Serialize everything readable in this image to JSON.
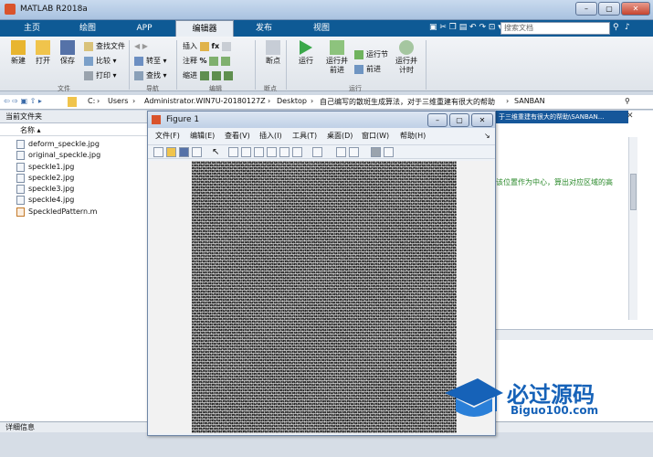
{
  "app": {
    "title": "MATLAB R2018a"
  },
  "tabs": [
    "主页",
    "绘图",
    "APP",
    "编辑器",
    "发布",
    "视图"
  ],
  "search": {
    "placeholder": "搜索文档"
  },
  "ribbon": {
    "file": {
      "new": "新建",
      "open": "打开",
      "save": "保存",
      "find_files": "查找文件",
      "compare": "比较",
      "print": "打印",
      "group": "文件"
    },
    "nav": {
      "goto": "转至",
      "find": "查找",
      "group": "导航"
    },
    "edit": {
      "insert": "插入",
      "comment": "注释",
      "indent": "缩进",
      "group": "编辑"
    },
    "breakpoints": {
      "label": "断点",
      "group": "断点"
    },
    "run": {
      "run": "运行",
      "run_advance": "运行并\n前进",
      "run_section": "运行节",
      "advance": "前进",
      "run_time": "运行并\n计时",
      "group": "运行"
    }
  },
  "address": {
    "path": [
      "C:",
      "Users",
      "Administrator.WIN7U-20180127Z",
      "Desktop",
      "自己编写的散斑生成算法，对于三维重建有很大的帮助",
      "SANBAN"
    ]
  },
  "current_folder": {
    "title": "当前文件夹",
    "column": "名称",
    "files": [
      "deform_speckle.jpg",
      "original_speckle.jpg",
      "speckle1.jpg",
      "speckle2.jpg",
      "speckle3.jpg",
      "speckle4.jpg",
      "SpeckledPattern.m"
    ]
  },
  "detail": {
    "label": "详细信息"
  },
  "editor": {
    "tab_title": "于三维重建有很大的帮助\\SANBAN...",
    "comment": "该位置作为中心，算出对应区域的高"
  },
  "figure": {
    "title": "Figure 1",
    "menu": [
      "文件(F)",
      "编辑(E)",
      "查看(V)",
      "插入(I)",
      "工具(T)",
      "桌面(D)",
      "窗口(W)",
      "帮助(H)"
    ]
  },
  "watermark": {
    "text": "必过源码",
    "url": "Biguo100.com"
  }
}
